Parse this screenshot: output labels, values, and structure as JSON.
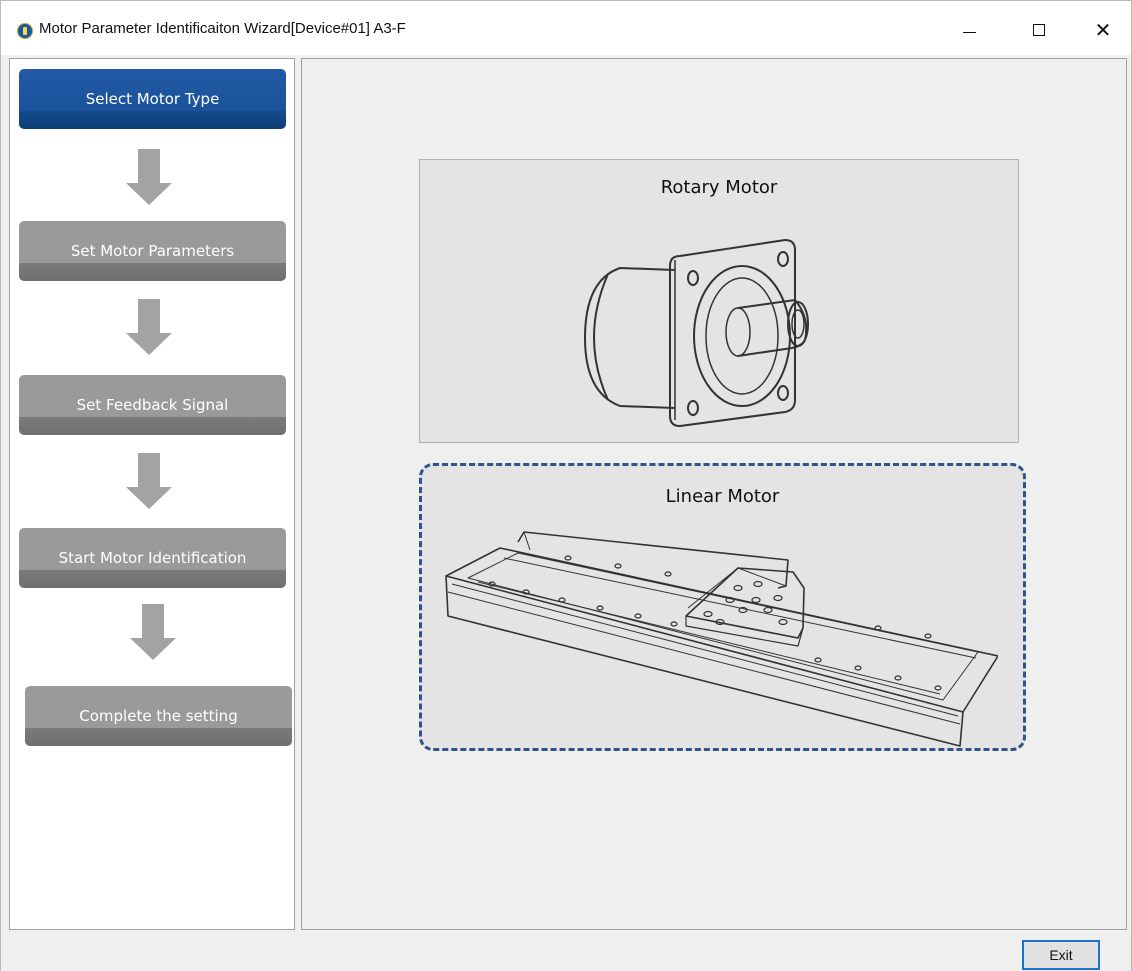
{
  "window": {
    "title": "Motor Parameter Identificaiton Wizard[Device#01] A3-F",
    "icon": "app-logo-icon",
    "controls": {
      "minimize": "minimize-icon",
      "maximize": "maximize-icon",
      "close": "close-icon"
    }
  },
  "steps": [
    {
      "label": "Select Motor Type",
      "state": "active"
    },
    {
      "label": "Set Motor Parameters",
      "state": "inactive"
    },
    {
      "label": "Set Feedback Signal",
      "state": "inactive"
    },
    {
      "label": "Start Motor Identification",
      "state": "inactive"
    },
    {
      "label": "Complete the setting",
      "state": "inactive"
    }
  ],
  "motor_types": [
    {
      "label": "Rotary Motor",
      "selected": false,
      "icon": "rotary-motor-illustration"
    },
    {
      "label": "Linear Motor",
      "selected": true,
      "icon": "linear-motor-illustration"
    }
  ],
  "footer": {
    "exit_label": "Exit"
  },
  "colors": {
    "active_step": "#19519a",
    "inactive_step": "#9a9a9a",
    "selection_border": "#2f5588",
    "focus_border": "#1f72c9"
  }
}
